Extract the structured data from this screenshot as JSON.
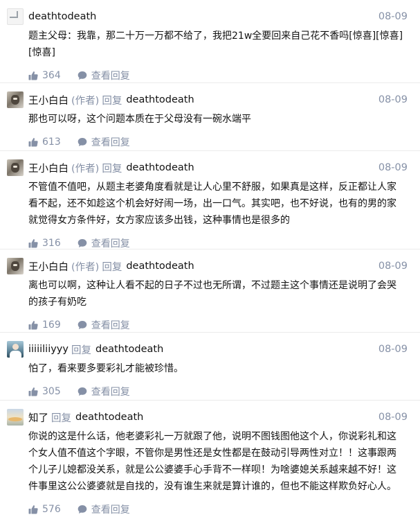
{
  "comments": [
    {
      "avatar": "blank-placeholder-avatar",
      "author": "deathtodeath",
      "author_tag": "",
      "reply_word": "",
      "reply_to": "",
      "date": "08-09",
      "content": "题主父母：我靠，那二十万一万都不给了，我把21w全要回来自己花不香吗[惊喜][惊喜]\n[惊喜]",
      "likes": "364",
      "view_replies": "查看回复"
    },
    {
      "avatar": "cat-avatar",
      "author": "王小白白",
      "author_tag": "(作者)",
      "reply_word": "回复",
      "reply_to": "deathtodeath",
      "date": "08-09",
      "content": "那也可以呀，这个问题本质在于父母没有一碗水端平",
      "likes": "613",
      "view_replies": "查看回复"
    },
    {
      "avatar": "cat-avatar",
      "author": "王小白白",
      "author_tag": "(作者)",
      "reply_word": "回复",
      "reply_to": "deathtodeath",
      "date": "08-09",
      "content": "不管值不值吧，从题主老婆角度看就是让人心里不舒服，如果真是这样，反正都让人家\n看不起，还不如趁这个机会好好闹一场，出一口气。其实吧，也不好说，也有的男的家\n就觉得女方条件好，女方家应该多出钱，这种事情也是很多的",
      "likes": "316",
      "view_replies": "查看回复"
    },
    {
      "avatar": "cat-avatar",
      "author": "王小白白",
      "author_tag": "(作者)",
      "reply_word": "回复",
      "reply_to": "deathtodeath",
      "date": "08-09",
      "content": "离也可以啊，这种让人看不起的日子不过也无所谓，不过题主这个事情还是说明了会哭\n的孩子有奶吃",
      "likes": "169",
      "view_replies": "查看回复"
    },
    {
      "avatar": "person-avatar",
      "author": "iiiiiliiyyy",
      "author_tag": "",
      "reply_word": "回复",
      "reply_to": "deathtodeath",
      "date": "08-09",
      "content": "怕了，看来要多要彩礼才能被珍惜。",
      "likes": "305",
      "view_replies": "查看回复"
    },
    {
      "avatar": "landscape-avatar",
      "author": "知了",
      "author_tag": "",
      "reply_word": "回复",
      "reply_to": "deathtodeath",
      "date": "08-09",
      "content": "你说的这是什么话，他老婆彩礼一万就跟了他，说明不图钱图他这个人，你说彩礼和这\n个女人值不值这个字眼，不管你是男性还是女性都是在鼓动引导两性对立！！这事跟两\n个儿子儿媳都没关系，就是公公婆婆手心手背不一样呗！为啥婆媳关系越来越不好！这\n件事里这公公婆婆就是自找的，没有谁生来就是算计谁的，但也不能这样欺负好心人。",
      "likes": "576",
      "view_replies": "查看回复"
    }
  ]
}
